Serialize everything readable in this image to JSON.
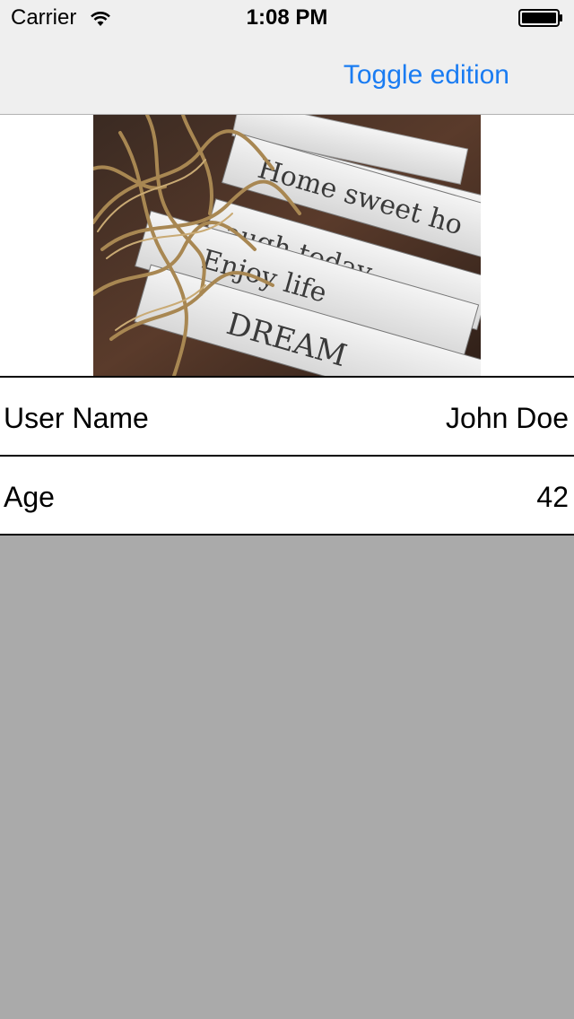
{
  "status_bar": {
    "carrier": "Carrier",
    "time": "1:08 PM",
    "icons": [
      "wifi-icon",
      "battery-icon"
    ]
  },
  "nav_bar": {
    "right_button_label": "Toggle edition"
  },
  "header_image": {
    "tag_texts": [
      "Home sweet ho",
      "augh today",
      "Enjoy life",
      "DREAM"
    ]
  },
  "rows": [
    {
      "label": "User Name",
      "value": "John Doe"
    },
    {
      "label": "Age",
      "value": "42"
    }
  ],
  "colors": {
    "accent": "#1a7cf2",
    "background": "#aaaaaa",
    "navbar": "#efefef"
  }
}
